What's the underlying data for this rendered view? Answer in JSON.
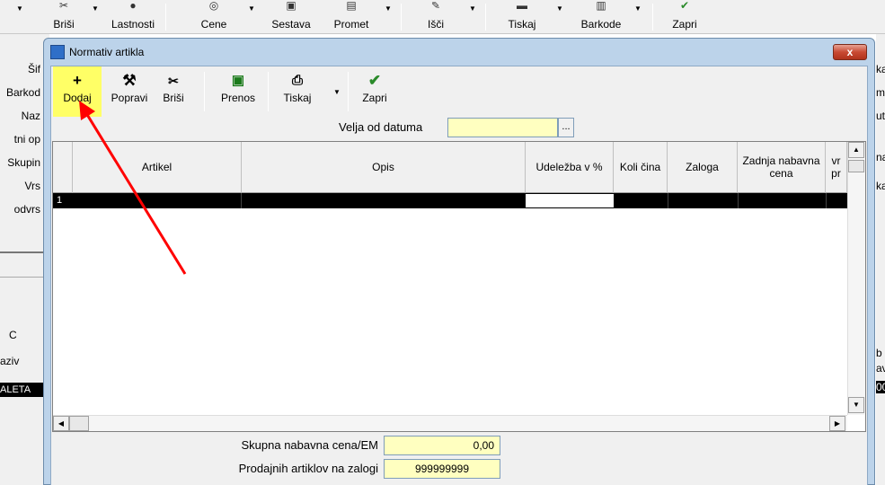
{
  "background_toolbar": {
    "buttons": [
      "Briši",
      "Lastnosti",
      "Cene",
      "Sestava",
      "Promet",
      "Išči",
      "Tiskaj",
      "Barkode",
      "Zapri"
    ]
  },
  "background_left_labels": [
    "Šif",
    "Barkod",
    "Naz",
    "tni op",
    "Skupin",
    "Vrs",
    "odvrs",
    "C",
    "aziv",
    "ALETA"
  ],
  "background_right_labels": [
    "ka",
    "m",
    "ut",
    "na",
    "ka",
    "b",
    "av",
    "00"
  ],
  "dialog": {
    "title": "Normativ artikla",
    "close_label": "x",
    "toolbar": {
      "dodaj": "Dodaj",
      "popravi": "Popravi",
      "brisi": "Briši",
      "prenos": "Prenos",
      "tiskaj": "Tiskaj",
      "zapri": "Zapri"
    },
    "date_filter": {
      "label": "Velja od datuma",
      "value": "",
      "picker_label": "..."
    },
    "grid": {
      "columns": [
        "Artikel",
        "Opis",
        "Udeležba v %",
        "Koli čina",
        "Zaloga",
        "Zadnja nabavna cena",
        "vr pr"
      ],
      "rows": [
        {
          "row_number": "1"
        }
      ]
    },
    "footer": {
      "total_label": "Skupna nabavna cena/EM",
      "total_value": "0,00",
      "stock_label": "Prodajnih artiklov na zalogi",
      "stock_value": "999999999"
    }
  },
  "colors": {
    "highlight": "#ffff66",
    "arrow": "#ff0000",
    "field_bg": "#ffffc0",
    "dialog_frame": "#bcd3ea"
  }
}
